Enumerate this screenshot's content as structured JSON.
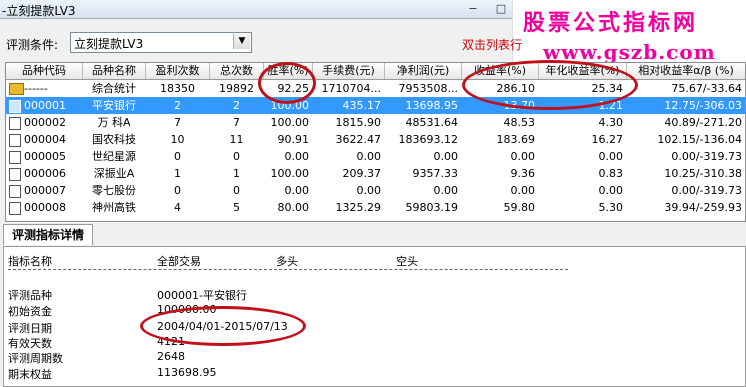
{
  "window": {
    "title": "-立刻提款LV3",
    "minimize": "−",
    "maximize": "□"
  },
  "watermark": {
    "line1": "股票公式指标网",
    "line2": "www.gszb.com"
  },
  "condition": {
    "label": "评测条件:",
    "value": "立刻提款LV3",
    "hint": "双击列表行"
  },
  "table": {
    "headers": [
      "品种代码",
      "品种名称",
      "盈利次数",
      "总次数",
      "胜率(%)",
      "手续费(元)",
      "净利润(元)",
      "收益率(%)",
      "年化收益率(%)",
      "相对收益率α/β (%)"
    ],
    "rows": [
      [
        "------",
        "综合统计",
        "18350",
        "19892",
        "92.25",
        "1710704...",
        "7953508...",
        "286.10",
        "25.34",
        "75.67/-33.64"
      ],
      [
        "000001",
        "平安银行",
        "2",
        "2",
        "100.00",
        "435.17",
        "13698.95",
        "13.70",
        "1.21",
        "12.75/-306.03"
      ],
      [
        "000002",
        "万  科A",
        "7",
        "7",
        "100.00",
        "1815.90",
        "48531.64",
        "48.53",
        "4.30",
        "40.89/-271.20"
      ],
      [
        "000004",
        "国农科技",
        "10",
        "11",
        "90.91",
        "3622.47",
        "183693.12",
        "183.69",
        "16.27",
        "102.15/-136.04"
      ],
      [
        "000005",
        "世纪星源",
        "0",
        "0",
        "0.00",
        "0.00",
        "0.00",
        "0.00",
        "0.00",
        "0.00/-319.73"
      ],
      [
        "000006",
        "深振业A",
        "1",
        "1",
        "100.00",
        "209.37",
        "9357.33",
        "9.36",
        "0.83",
        "10.25/-310.38"
      ],
      [
        "000007",
        "零七股份",
        "0",
        "0",
        "0.00",
        "0.00",
        "0.00",
        "0.00",
        "0.00",
        "0.00/-319.73"
      ],
      [
        "000008",
        "神州高铁",
        "4",
        "5",
        "80.00",
        "1325.29",
        "59803.19",
        "59.80",
        "5.30",
        "39.94/-259.93"
      ]
    ]
  },
  "detail": {
    "tab": "评测指标详情",
    "columns": [
      "指标名称",
      "全部交易",
      "多头",
      "空头"
    ],
    "items": [
      {
        "label": "评测品种",
        "value": "000001-平安银行"
      },
      {
        "label": "初始资金",
        "value": "100000.00"
      },
      {
        "label": "评测日期",
        "value": "2004/04/01-2015/07/13"
      },
      {
        "label": "有效天数",
        "value": "4121"
      },
      {
        "label": "评测周期数",
        "value": "2648"
      },
      {
        "label": "期末权益",
        "value": "113698.95"
      }
    ]
  }
}
